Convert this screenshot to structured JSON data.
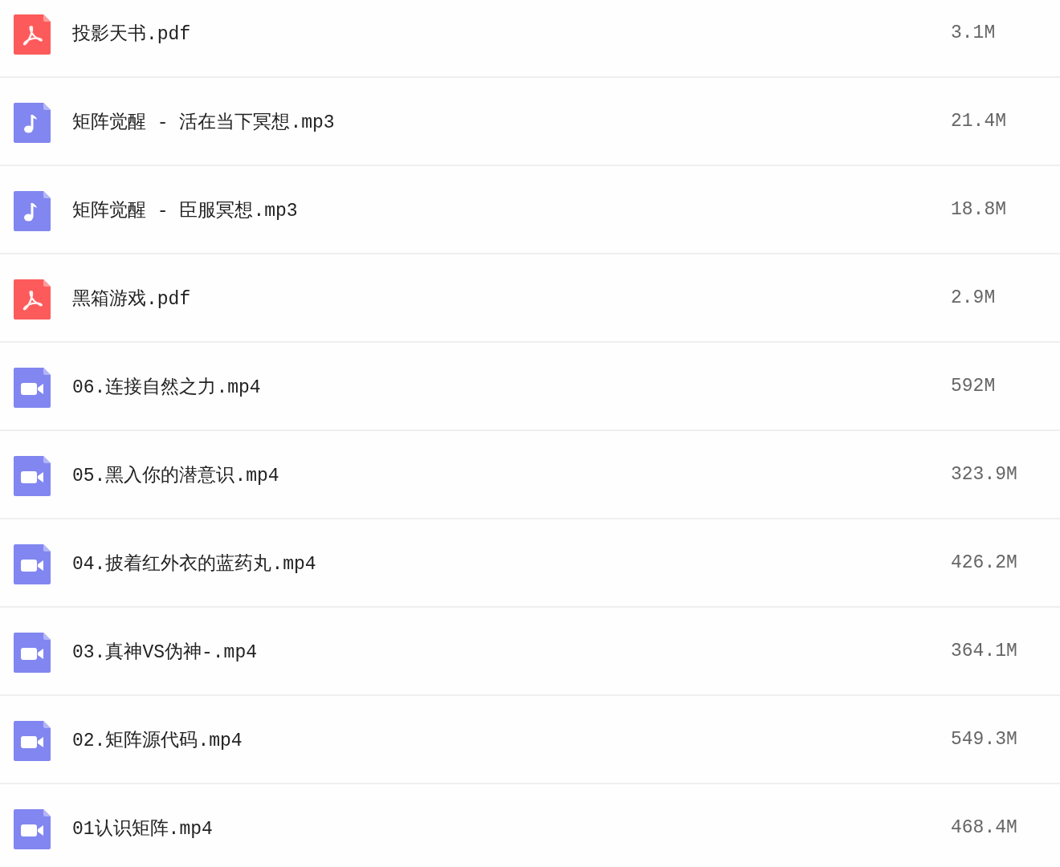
{
  "files": [
    {
      "kind": "pdf",
      "name": "投影天书.pdf",
      "size": "3.1M"
    },
    {
      "kind": "audio",
      "name": "矩阵觉醒 - 活在当下冥想.mp3",
      "size": "21.4M"
    },
    {
      "kind": "audio",
      "name": "矩阵觉醒 - 臣服冥想.mp3",
      "size": "18.8M"
    },
    {
      "kind": "pdf",
      "name": "黑箱游戏.pdf",
      "size": "2.9M"
    },
    {
      "kind": "video",
      "name": "06.连接自然之力.mp4",
      "size": "592M"
    },
    {
      "kind": "video",
      "name": "05.黑入你的潜意识.mp4",
      "size": "323.9M"
    },
    {
      "kind": "video",
      "name": "04.披着红外衣的蓝药丸.mp4",
      "size": "426.2M"
    },
    {
      "kind": "video",
      "name": "03.真神VS伪神-.mp4",
      "size": "364.1M"
    },
    {
      "kind": "video",
      "name": "02.矩阵源代码.mp4",
      "size": "549.3M"
    },
    {
      "kind": "video",
      "name": "01认识矩阵.mp4",
      "size": "468.4M"
    }
  ]
}
